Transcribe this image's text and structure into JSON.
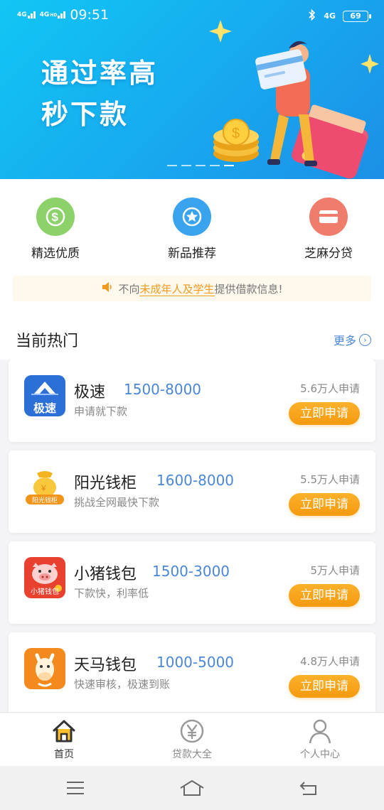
{
  "status_bar": {
    "time": "09:51",
    "sim1": "4G",
    "sim2": "4G",
    "sim2_sup": "HD",
    "battery": "69"
  },
  "banner": {
    "line1": "通过率高",
    "line2": "秒下款"
  },
  "categories": [
    {
      "label": "精选优质",
      "icon": "dollar-icon",
      "color": "#8cd16a"
    },
    {
      "label": "新品推荐",
      "icon": "star-icon",
      "color": "#3aa3ee"
    },
    {
      "label": "芝麻分贷",
      "icon": "card-icon",
      "color": "#f07d6c"
    }
  ],
  "notice": {
    "prefix": "不向",
    "highlight": "未成年人及学生",
    "suffix": "提供借款信息!"
  },
  "hot": {
    "title": "当前热门",
    "more": "更多"
  },
  "products": [
    {
      "name": "极速",
      "range": "1500-8000",
      "desc": "申请就下款",
      "count": "5.6万人申请",
      "apply": "立即申请",
      "logo_text": "极速"
    },
    {
      "name": "阳光钱柜",
      "range": "1600-8000",
      "desc": "挑战全网最快下款",
      "count": "5.5万人申请",
      "apply": "立即申请",
      "logo_text": "阳光钱柜"
    },
    {
      "name": "小猪钱包",
      "range": "1500-3000",
      "desc": "下款快，利率低",
      "count": "5万人申请",
      "apply": "立即申请",
      "logo_text": "小猪钱包"
    },
    {
      "name": "天马钱包",
      "range": "1000-5000",
      "desc": "快速审核，极速到账",
      "count": "4.8万人申请",
      "apply": "立即申请",
      "logo_text": ""
    }
  ],
  "tabs": [
    {
      "label": "首页",
      "icon": "home-icon",
      "active": true
    },
    {
      "label": "贷款大全",
      "icon": "yen-icon",
      "active": false
    },
    {
      "label": "个人中心",
      "icon": "person-icon",
      "active": false
    }
  ],
  "accent_color": "#f59a0f",
  "link_color": "#4a87d6"
}
